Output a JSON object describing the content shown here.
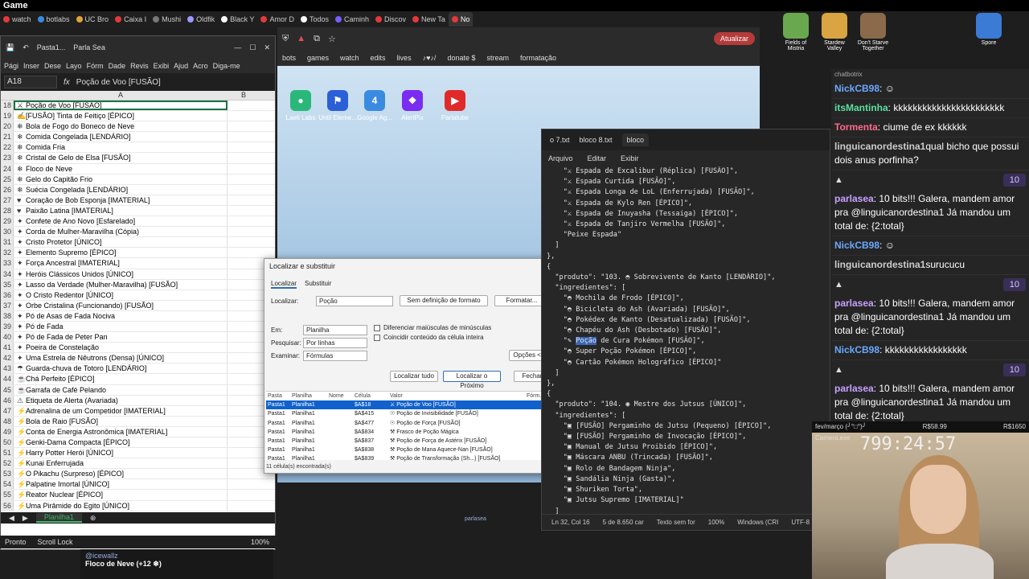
{
  "game_title": "Game",
  "browser_tabs": [
    {
      "label": "watch",
      "color": "#e03a3a"
    },
    {
      "label": "botlabs",
      "color": "#3a8be0"
    },
    {
      "label": "UC Bro",
      "color": "#e0a23a"
    },
    {
      "label": "Caixa I",
      "color": "#e03a3a"
    },
    {
      "label": "Mushi",
      "color": "#777777"
    },
    {
      "label": "Oldfik",
      "color": "#9a9aff"
    },
    {
      "label": "Black Y",
      "color": "#ffffff"
    },
    {
      "label": "Amor D",
      "color": "#e03a3a"
    },
    {
      "label": "Todos",
      "color": "#ffffff"
    },
    {
      "label": "Caminh",
      "color": "#7a5cff"
    },
    {
      "label": "Discov",
      "color": "#e03a3a"
    },
    {
      "label": "New Ta",
      "color": "#e03a3a"
    },
    {
      "label": "No",
      "color": "#e03a3a"
    }
  ],
  "browser_update_label": "Atualizar",
  "bookmarks": [
    "bots",
    "games",
    "watch",
    "edits",
    "lives",
    "♪♥♪/",
    "donate $",
    "stream",
    "formatação"
  ],
  "shortcuts": [
    {
      "label": "Laeti Labs",
      "color": "#2ab87a",
      "glyph": "●"
    },
    {
      "label": "Until Eleme...",
      "color": "#2b5fd8",
      "glyph": "⚑"
    },
    {
      "label": "Google Ag...",
      "color": "#3a8be0",
      "glyph": "4"
    },
    {
      "label": "AlertPix",
      "color": "#7a2cf0",
      "glyph": "❖"
    },
    {
      "label": "Parlatube",
      "color": "#e02a2a",
      "glyph": "▶"
    }
  ],
  "excel": {
    "quick_title": "Pasta1...",
    "quick_title2": "Parla Sea",
    "ribbon": [
      "Pági",
      "Inser",
      "Dese",
      "Layo",
      "Fórm",
      "Dade",
      "Revis",
      "Exibi",
      "Ajud",
      "Acro",
      "Diga-me"
    ],
    "name_box": "A18",
    "formula_value": "Poção de Voo [FUSÃO]",
    "col_a": "A",
    "col_b": "B",
    "rows": [
      {
        "n": "18",
        "icon": "⚔",
        "text": "Poção de Voo [FUSÃO]"
      },
      {
        "n": "19",
        "icon": "✍",
        "text": "[FUSÃO] Tinta de Feitiço [ÉPICO]"
      },
      {
        "n": "20",
        "icon": "❄",
        "text": "Bola de Fogo do Boneco de Neve"
      },
      {
        "n": "21",
        "icon": "❄",
        "text": "Comida Congelada [LENDÁRIO]"
      },
      {
        "n": "22",
        "icon": "❄",
        "text": "Comida Fria"
      },
      {
        "n": "23",
        "icon": "❄",
        "text": "Cristal de Gelo de Elsa [FUSÃO]"
      },
      {
        "n": "24",
        "icon": "❄",
        "text": "Floco de Neve"
      },
      {
        "n": "25",
        "icon": "❄",
        "text": "Gelo do Capitão Frio"
      },
      {
        "n": "26",
        "icon": "❄",
        "text": "Suécia Congelada [LENDÁRIO]"
      },
      {
        "n": "27",
        "icon": "♥",
        "text": "Coração de Bob Esponja [IMATERIAL]"
      },
      {
        "n": "28",
        "icon": "♥",
        "text": "Paixão Latina [IMATERIAL]"
      },
      {
        "n": "29",
        "icon": "✦",
        "text": "Confete de Ano Novo [Esfarelado]"
      },
      {
        "n": "30",
        "icon": "✦",
        "text": "Corda de Mulher-Maravilha (Cópia)"
      },
      {
        "n": "31",
        "icon": "✦",
        "text": "Cristo Protetor [ÚNICO]"
      },
      {
        "n": "32",
        "icon": "✦",
        "text": "Elemento Supremo [ÉPICO]"
      },
      {
        "n": "33",
        "icon": "✦",
        "text": "Força Ancestral [IMATERIAL]"
      },
      {
        "n": "34",
        "icon": "✦",
        "text": "Heróis Clássicos Unidos [ÚNICO]"
      },
      {
        "n": "35",
        "icon": "✦",
        "text": "Lasso da Verdade (Mulher-Maravilha) [FUSÃO]"
      },
      {
        "n": "36",
        "icon": "✦",
        "text": "O Cristo Redentor [ÚNICO]"
      },
      {
        "n": "37",
        "icon": "✦",
        "text": "Orbe Cristalina (Funcionando) [FUSÃO]"
      },
      {
        "n": "38",
        "icon": "✦",
        "text": "Pó de Asas de Fada Nociva"
      },
      {
        "n": "39",
        "icon": "✦",
        "text": "Pó de Fada"
      },
      {
        "n": "40",
        "icon": "✦",
        "text": "Pó de Fada de Peter Pan"
      },
      {
        "n": "41",
        "icon": "✦",
        "text": "Poeira de Constelação"
      },
      {
        "n": "42",
        "icon": "✦",
        "text": "Uma Estrela de Nêutrons (Densa) [ÚNICO]"
      },
      {
        "n": "43",
        "icon": "☂",
        "text": "Guarda-chuva de Totoro [LENDÁRIO]"
      },
      {
        "n": "44",
        "icon": "☕",
        "text": "Chá Perfeito [ÉPICO]"
      },
      {
        "n": "45",
        "icon": "☕",
        "text": "Garrafa de Café Pelando"
      },
      {
        "n": "46",
        "icon": "⚠",
        "text": "Etiqueta de Alerta (Avariada)"
      },
      {
        "n": "47",
        "icon": "⚡",
        "text": "Adrenalina de um Competidor [IMATERIAL]"
      },
      {
        "n": "48",
        "icon": "⚡",
        "text": "Bola de Raio [FUSÃO]"
      },
      {
        "n": "49",
        "icon": "⚡",
        "text": "Conta de Energia Astronômica [IMATERIAL]"
      },
      {
        "n": "50",
        "icon": "⚡",
        "text": "Genki-Dama Compacta [ÉPICO]"
      },
      {
        "n": "51",
        "icon": "⚡",
        "text": "Harry Potter Herói [ÚNICO]"
      },
      {
        "n": "52",
        "icon": "⚡",
        "text": "Kunai Enferrujada"
      },
      {
        "n": "53",
        "icon": "⚡",
        "text": "O Pikachu (Surpreso) [ÉPICO]"
      },
      {
        "n": "54",
        "icon": "⚡",
        "text": "Palpatine Imortal [ÚNICO]"
      },
      {
        "n": "55",
        "icon": "⚡",
        "text": "Reator Nuclear [ÉPICO]"
      },
      {
        "n": "56",
        "icon": "⚡",
        "text": "Uma Pirâmide do Egito [ÚNICO]"
      }
    ],
    "sheet_tab": "Planilha1",
    "status": [
      "Pronto",
      "Scroll Lock"
    ],
    "zoom": "100%"
  },
  "dialog": {
    "title": "Localizar e substituir",
    "tab_find": "Localizar",
    "tab_replace": "Substituir",
    "find_label": "Localizar:",
    "find_value": "Poção",
    "no_format": "Sem definição de formato",
    "format_btn": "Formatar...",
    "within_label": "Em:",
    "within_value": "Planilha",
    "search_label": "Pesquisar:",
    "search_value": "Por linhas",
    "lookin_label": "Examinar:",
    "lookin_value": "Fórmulas",
    "match_case": "Diferenciar maiúsculas de minúsculas",
    "match_entire": "Coincidir conteúdo da célula inteira",
    "options_btn": "Opções <<",
    "find_all": "Localizar tudo",
    "find_next": "Localizar o Próximo",
    "close": "Fechar",
    "headers": [
      "Pasta",
      "Planilha",
      "Nome",
      "Célula",
      "Valor",
      "Fórm..."
    ],
    "results": [
      {
        "book": "Pasta1",
        "sheet": "Planilha1",
        "cell": "$A$18",
        "value": "⚔ Poção de Voo [FUSÃO]"
      },
      {
        "book": "Pasta1",
        "sheet": "Planilha1",
        "cell": "$A$415",
        "value": "☉ Poção de Invisibilidade [FUSÃO]"
      },
      {
        "book": "Pasta1",
        "sheet": "Planilha1",
        "cell": "$A$477",
        "value": "☉ Poção de Força [FUSÃO]"
      },
      {
        "book": "Pasta1",
        "sheet": "Planilha1",
        "cell": "$A$834",
        "value": "⚒ Frasco de Poção Mágica"
      },
      {
        "book": "Pasta1",
        "sheet": "Planilha1",
        "cell": "$A$837",
        "value": "⚒ Poção de Força de Astérix [FUSÃO]"
      },
      {
        "book": "Pasta1",
        "sheet": "Planilha1",
        "cell": "$A$838",
        "value": "⚒ Poção de Mana Aquece-Nan [FUSÃO]"
      },
      {
        "book": "Pasta1",
        "sheet": "Planilha1",
        "cell": "$A$839",
        "value": "⚒ Poção de Transformação (Sh...) [FUSÃO]"
      }
    ],
    "found_text": "11 célula(s) encontrada(s)"
  },
  "notepad": {
    "tabs": [
      "o 7.txt",
      "bloco 8.txt",
      "bloco"
    ],
    "menu": [
      "Arquivo",
      "Editar",
      "Exibir"
    ],
    "lines": [
      "    \"⚔ Espada de Excalibur (Réplica) [FUSÃO]\",",
      "    \"⚔ Espada Curtida [FUSÃO]\",",
      "    \"⚔ Espada Longa de LoL (Enferrujada) [FUSÃO]\",",
      "    \"⚔ Espada de Kylo Ren [ÉPICO]\",",
      "    \"⚔ Espada de Inuyasha (Tessaiga) [ÉPICO]\",",
      "    \"⚔ Espada de Tanjiro Vermelha [FUSÃO]\",",
      "    \"Peixe Espada\"",
      "  ]",
      "},",
      "{",
      "  \"produto\": \"103. ◓ Sobrevivente de Kanto [LENDÁRIO]\",",
      "  \"ingredientes\": [",
      "    \"◓ Mochila de Frodo [ÉPICO]\",",
      "    \"◓ Bicicleta do Ash (Avariada) [FUSÃO]\",",
      "    \"◓ Pokédex de Kanto (Desatualizada) [FUSÃO]\",",
      "    \"◓ Chapéu do Ash (Desbotado) [FUSÃO]\",",
      "    \"✎ Poção de Cura Pokémon [FUSÃO]\",",
      "    \"◓ Super Poção Pokémon [ÉPICO]\",",
      "    \"◓ Cartão Pokémon Holográfico [ÉPICO]\"",
      "  ]",
      "},",
      "{",
      "  \"produto\": \"104. ◉ Mestre dos Jutsus [ÚNICO]\",",
      "  \"ingredientes\": [",
      "    \"▣ [FUSÃO] Pergaminho de Jutsu (Pequeno) [ÉPICO]\",",
      "    \"▣ [FUSÃO] Pergaminho de Invocação [ÉPICO]\",",
      "    \"▣ Manual de Jutsu Proibido [ÉPICO]\",",
      "    \"▣ Máscara ANBU (Trincada) [FUSÃO]\",",
      "    \"▣ Rolo de Bandagem Ninja\",",
      "    \"▣ Sandália Ninja (Gasta)\",",
      "    \"▣ Shuriken Torta\",",
      "    \"▣ Jutsu Supremo [IMATERIAL]\"",
      "  ]",
      "},"
    ],
    "status": [
      "Ln 32, Col 16",
      "5 de 8.650 car",
      "Texto sem for",
      "100%",
      "Windows (CRI",
      "UTF-8"
    ]
  },
  "chat": {
    "header": "chatbotrix",
    "messages": [
      {
        "nick": "NickCB98",
        "color": "#6aa8ff",
        "text": ": ☺"
      },
      {
        "nick": "itsMantinha",
        "color": "#5be0a0",
        "text": ": kkkkkkkkkkkkkkkkkkkkkkk"
      },
      {
        "nick": "Tormenta",
        "color": "#ff6a8a",
        "text": ": ciume de ex kkkkkk"
      },
      {
        "nick": "linguicanordestina1",
        "color": "#cccccc",
        "text": "qual bicho que possui dois anus porfinha?"
      },
      {
        "nick": "parlasea",
        "color": "#c8a0ff",
        "text": ": 10 bits!!! Galera, mandem amor pra @linguicanordestina1 Já mandou um total de: {2:total}"
      },
      {
        "nick": "NickCB98",
        "color": "#6aa8ff",
        "text": ": ☺"
      },
      {
        "nick": "linguicanordestina1",
        "color": "#cccccc",
        "text": "surucucu"
      },
      {
        "nick": "parlasea",
        "color": "#c8a0ff",
        "text": ": 10 bits!!! Galera, mandem amor pra @linguicanordestina1 Já mandou um total de: {2:total}"
      },
      {
        "nick": "NickCB98",
        "color": "#6aa8ff",
        "text": ": kkkkkkkkkkkkkkkkk"
      },
      {
        "nick": "parlasea",
        "color": "#c8a0ff",
        "text": ": 10 bits!!! Galera, mandem amor pra @linguicanordestina1 Já mandou um total de: {2:total}"
      },
      {
        "nick": "NickCB98",
        "color": "#6aa8ff",
        "text": ": kkkkkkkkkkkkkkkk"
      }
    ],
    "bits_value": "10"
  },
  "desktop_icons": [
    {
      "label": "Fields of Mistria",
      "color": "#6aa84f"
    },
    {
      "label": "Stardew Valley",
      "color": "#d9a441"
    },
    {
      "label": "Don't Starve Together",
      "color": "#8a6a4a"
    },
    {
      "label": "Spore",
      "color": "#3b7bd6"
    }
  ],
  "stream": {
    "month_label": "fev/março (╯°□°)╯",
    "goal_current": "R$58.99",
    "goal_target": "R$1650",
    "timer": "799:24:57",
    "cam_label": "Camera.exe"
  },
  "bottom_chat": {
    "user": "@icewallz",
    "subtitle": "Floco de Neve (+12 ❄)",
    "sender": "parlasea"
  }
}
